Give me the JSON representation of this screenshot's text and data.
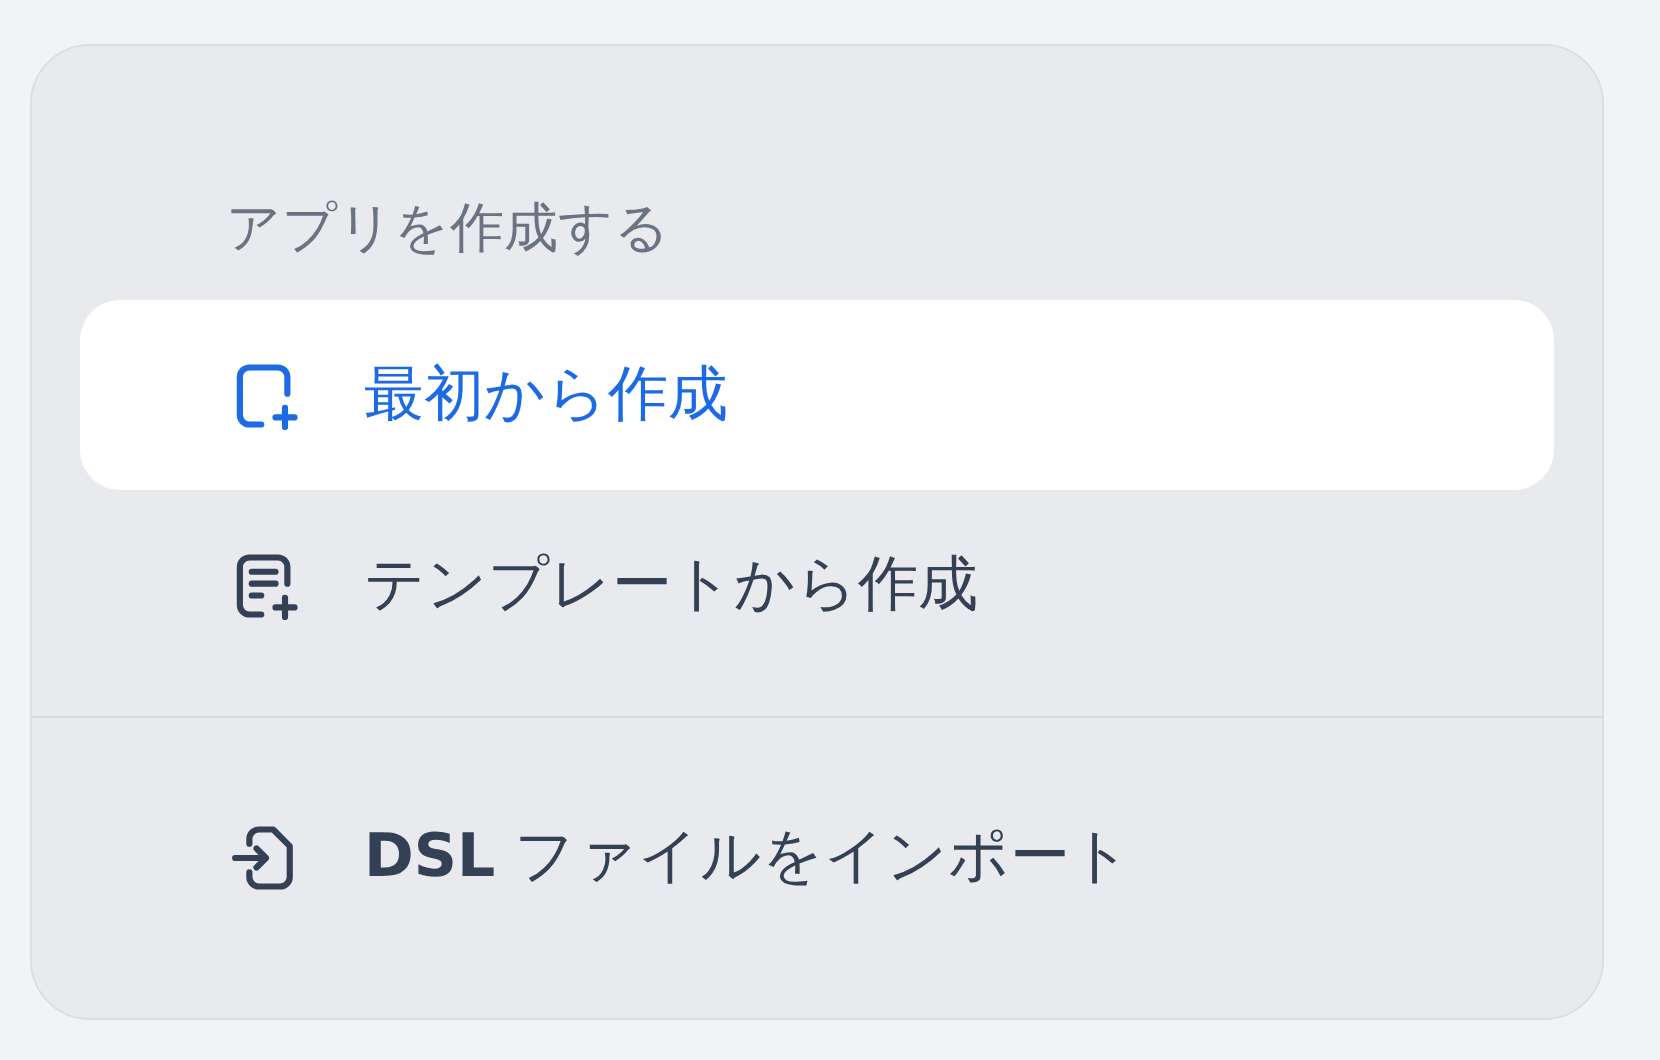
{
  "menu": {
    "sections": [
      {
        "title": "アプリを作成する",
        "items": [
          {
            "kind": "blank",
            "label": "最初から作成",
            "selected": true
          },
          {
            "kind": "template",
            "label": "テンプレートから作成",
            "selected": false
          }
        ]
      },
      {
        "items": [
          {
            "kind": "import",
            "label": "**DSL** ファイルをインポート",
            "selected": false
          }
        ]
      }
    ]
  }
}
